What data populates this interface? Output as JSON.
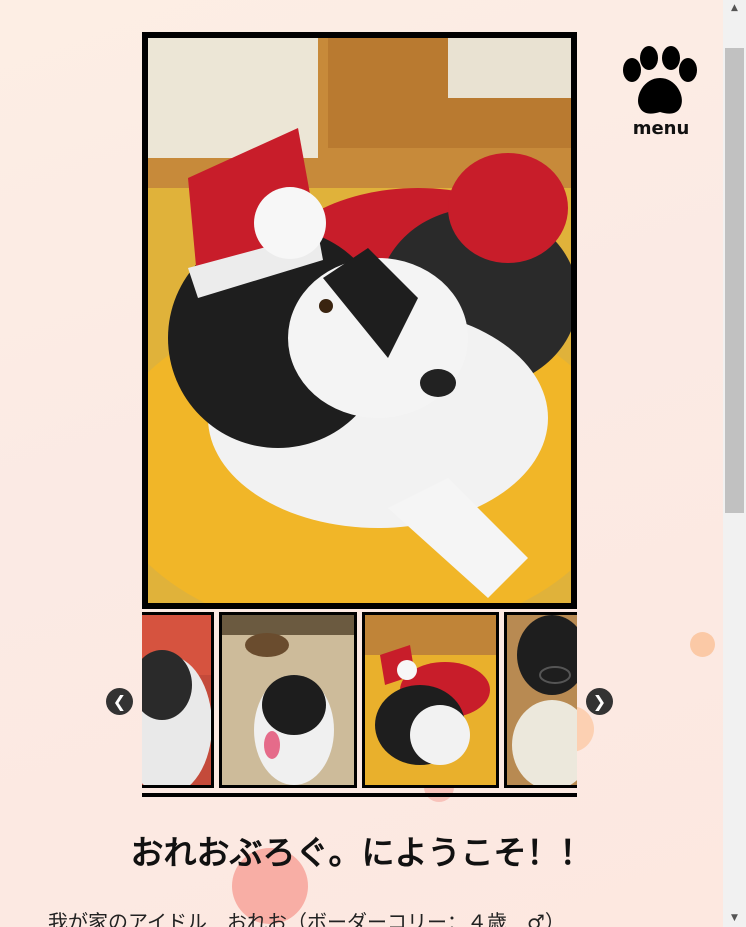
{
  "menu": {
    "label": "menu",
    "icon": "paw-icon"
  },
  "gallery": {
    "main_photo": "dog-in-santa-hat-photo",
    "thumbnails": [
      {
        "name": "dog-with-autumn-leaves-photo"
      },
      {
        "name": "dog-with-deer-photo"
      },
      {
        "name": "dog-in-santa-hat-photo"
      },
      {
        "name": "dog-with-glasses-photo"
      }
    ],
    "prev_icon": "chevron-left-icon",
    "next_icon": "chevron-right-icon",
    "prev_glyph": "❮",
    "next_glyph": "❯"
  },
  "content": {
    "title": "おれおぶろぐ。にようこそ！！",
    "intro": "我が家のアイドル　おれお（ボーダーコリー：４歳　♂）"
  },
  "scrollbar": {
    "up_glyph": "▲",
    "down_glyph": "▼"
  },
  "colors": {
    "background": "#fdeee4",
    "bubble": "#f8a98c",
    "frame": "#000000"
  }
}
